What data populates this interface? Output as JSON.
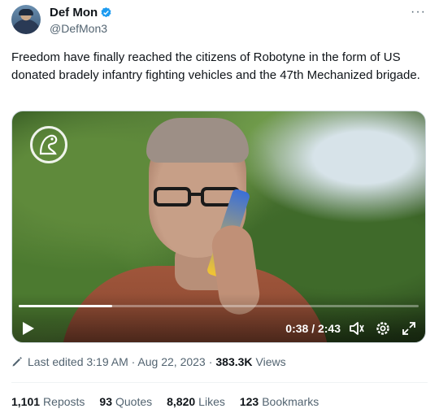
{
  "author": {
    "display_name": "Def Mon",
    "handle": "@DefMon3",
    "verified": true,
    "avatar_icon": "avatar"
  },
  "more_menu": {
    "icon": "more-horizontal-icon",
    "label": "···"
  },
  "tweet": {
    "text": "Freedom have finally reached the citizens of Robotyne in the form of US donated bradely infantry fighting vehicles and the 47th Mechanized brigade."
  },
  "video": {
    "time_display": "0:38 / 2:43",
    "progress_fraction": 0.234,
    "controls": {
      "play_icon": "play-icon",
      "volume_icon": "volume-icon",
      "settings_icon": "gear-icon",
      "fullscreen_icon": "fullscreen-icon"
    }
  },
  "meta": {
    "edited_text": "Last edited 3:19 AM · Aug 22, 2023",
    "separator": "·",
    "views_count": "383.3K",
    "views_label": "Views"
  },
  "stats": [
    {
      "count": "1,101",
      "label": "Reposts"
    },
    {
      "count": "93",
      "label": "Quotes"
    },
    {
      "count": "8,820",
      "label": "Likes"
    },
    {
      "count": "123",
      "label": "Bookmarks"
    }
  ],
  "colors": {
    "text_primary": "#0f1419",
    "text_secondary": "#536471",
    "verified_blue": "#1d9bf0"
  }
}
